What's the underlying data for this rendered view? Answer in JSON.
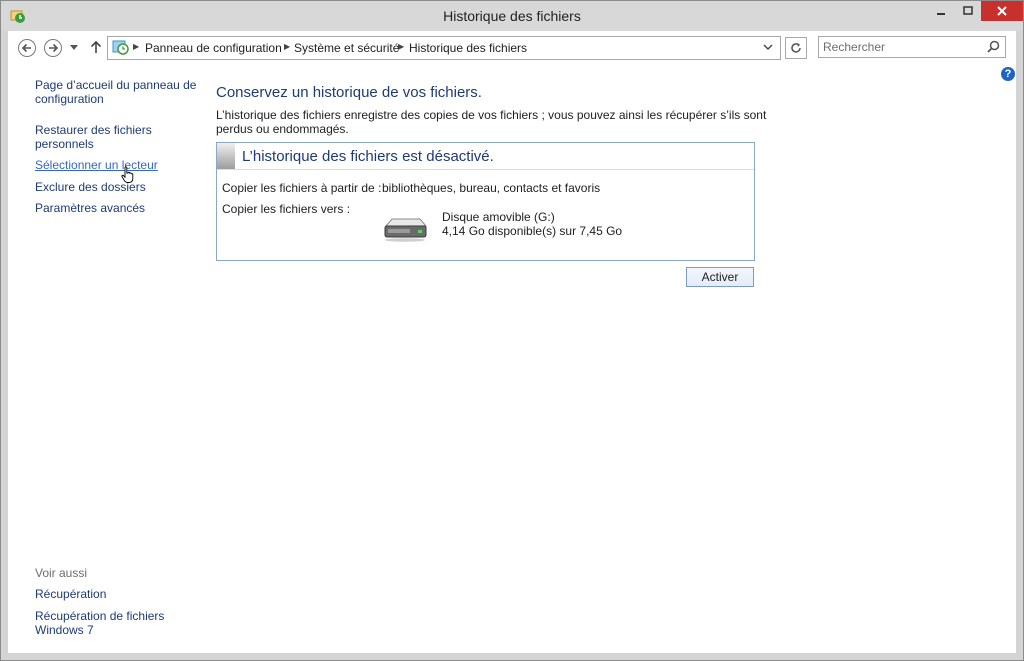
{
  "window": {
    "title": "Historique des fichiers",
    "controls": {
      "minimize": "–",
      "maximize": "□",
      "close": "✕"
    }
  },
  "navigation": {
    "breadcrumbs": [
      "Panneau de configuration",
      "Système et sécurité",
      "Historique des fichiers"
    ],
    "search_placeholder": "Rechercher"
  },
  "help": {
    "label": "?"
  },
  "sidebar": {
    "links": [
      {
        "label_line1": "Page d’accueil du panneau de",
        "label_line2": "configuration"
      },
      {
        "label_line1": "Restaurer des fichiers",
        "label_line2": "personnels"
      },
      {
        "label": "Sélectionner un lecteur"
      },
      {
        "label": "Exclure des dossiers"
      },
      {
        "label": "Paramètres avancés"
      }
    ],
    "see_also": {
      "heading": "Voir aussi",
      "links": [
        {
          "label": "Récupération"
        },
        {
          "label_line1": "Récupération de fichiers",
          "label_line2": "Windows 7"
        }
      ]
    }
  },
  "main": {
    "title": "Conservez un historique de vos fichiers.",
    "description": "L’historique des fichiers enregistre des copies de vos fichiers ; vous pouvez ainsi les récupérer s’ils sont perdus ou endommagés.",
    "panel": {
      "status_title": "L’historique des fichiers est désactivé.",
      "copy_from_label": "Copier les fichiers à partir de :",
      "copy_from_value": "bibliothèques, bureau, contacts et favoris",
      "copy_to_label": "Copier les fichiers vers :",
      "drive_name": "Disque amovible (G:)",
      "drive_space": "4,14 Go disponible(s) sur 7,45 Go"
    },
    "activate_button": "Activer"
  },
  "colors": {
    "link": "#1e3a78",
    "close_button": "#c7302c",
    "panel_border": "#8aa7cc"
  }
}
